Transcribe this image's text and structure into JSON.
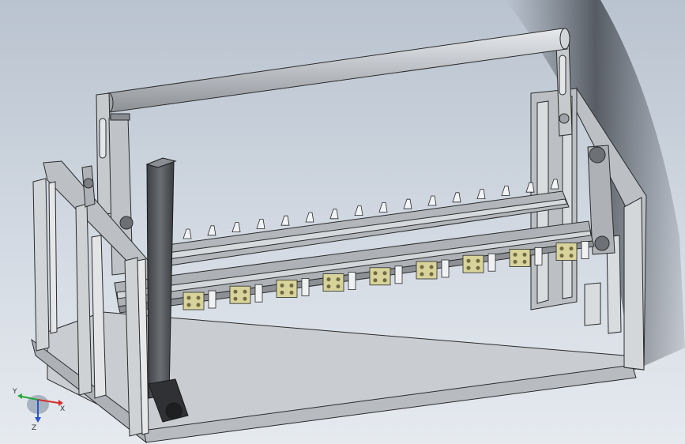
{
  "viewport": {
    "background_top": "#b9c3cf",
    "background_bottom": "#e6eaef",
    "model_color": "#c4c8cc",
    "edge_color": "#2b2b2b",
    "bracket_color": "#d8d39a",
    "post_color": "#4a4c50"
  },
  "triad": {
    "x_label": "X",
    "y_label": "Y",
    "z_label": "Z",
    "x_color": "#d4302b",
    "y_color": "#26a63c",
    "z_color": "#2a54c8"
  }
}
